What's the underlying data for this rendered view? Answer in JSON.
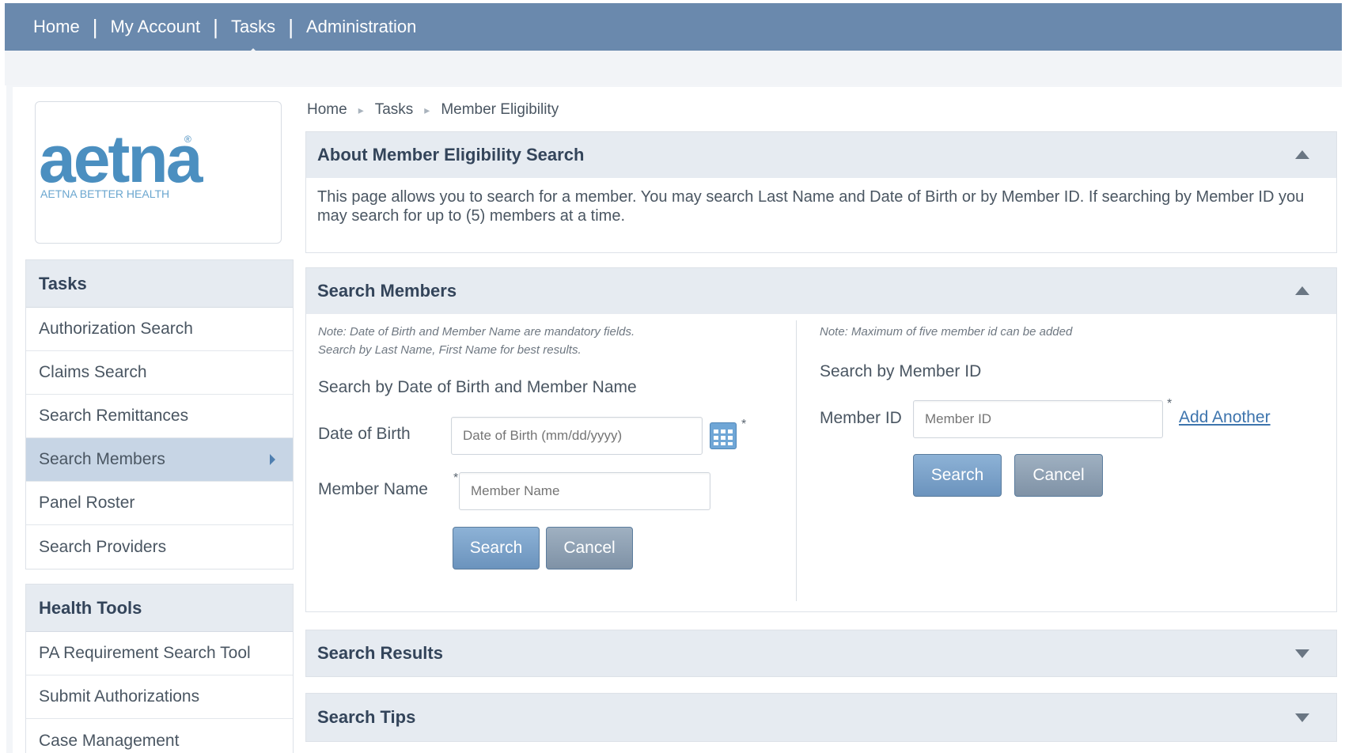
{
  "topnav": {
    "items": [
      "Home",
      "My Account",
      "Tasks",
      "Administration"
    ],
    "active": "Tasks"
  },
  "logo": {
    "wordmark": "aetna",
    "tagline": "AETNA BETTER HEALTH"
  },
  "sidebar": {
    "tasks_title": "Tasks",
    "tasks": [
      "Authorization Search",
      "Claims Search",
      "Search Remittances",
      "Search Members",
      "Panel Roster",
      "Search Providers"
    ],
    "selected": "Search Members",
    "health_tools_title": "Health Tools",
    "health_tools": [
      "PA Requirement Search Tool",
      "Submit Authorizations",
      "Case Management"
    ]
  },
  "breadcrumb": [
    "Home",
    "Tasks",
    "Member Eligibility"
  ],
  "about": {
    "title": "About Member Eligibility Search",
    "text": "This page allows you to search for a member. You may search Last Name and Date of Birth or by Member ID. If searching by Member ID you may search for up to (5) members at a time."
  },
  "search_members": {
    "title": "Search Members",
    "left": {
      "note_line1": "Note: Date of Birth and Member Name are mandatory fields.",
      "note_line2": "Search by Last Name, First Name for best results.",
      "subtitle": "Search by Date of Birth and Member Name",
      "dob_label": "Date of Birth",
      "dob_placeholder": "Date of Birth (mm/dd/yyyy)",
      "name_label": "Member Name",
      "name_placeholder": "Member Name",
      "required_mark": "*",
      "search_label": "Search",
      "cancel_label": "Cancel"
    },
    "right": {
      "note": "Note: Maximum of five member id can be added",
      "subtitle": "Search by Member ID",
      "id_label": "Member ID",
      "id_placeholder": "Member ID",
      "required_mark": "*",
      "add_another": "Add Another",
      "search_label": "Search",
      "cancel_label": "Cancel"
    }
  },
  "results": {
    "title": "Search Results"
  },
  "tips": {
    "title": "Search Tips"
  },
  "colors": {
    "nav_bg": "#6a89ad",
    "panel_head_bg": "#e6ebf1",
    "brand": "#4b8fc0",
    "selected_item": "#c7d5e5",
    "link": "#3d74ad"
  },
  "icons": [
    "calendar-icon",
    "chevron-up-icon",
    "chevron-down-icon",
    "chevron-right-icon"
  ]
}
